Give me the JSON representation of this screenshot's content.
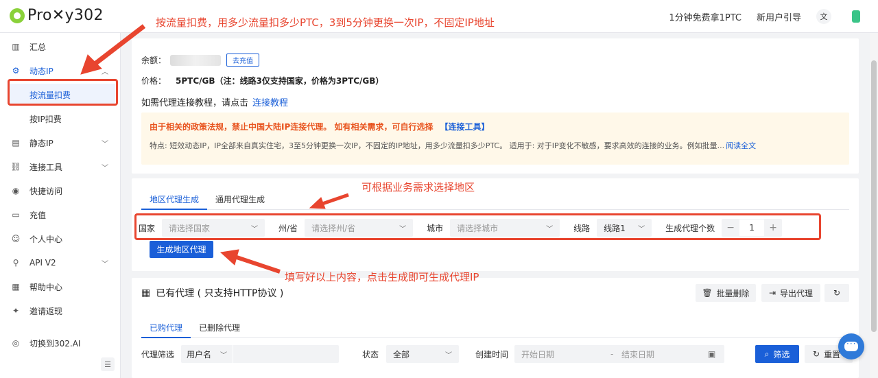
{
  "header": {
    "logo_text": "Pro✕y302",
    "free_link": "1分钟免费拿1PTC",
    "guide_link": "新用户引导",
    "lang_icon": "translate-icon"
  },
  "sidebar": {
    "items": [
      {
        "label": "汇总",
        "icon": "bar-chart-icon"
      },
      {
        "label": "动态IP",
        "icon": "gear-icon"
      },
      {
        "label": "按流量扣费"
      },
      {
        "label": "按IP扣费"
      },
      {
        "label": "静态IP",
        "icon": "server-icon"
      },
      {
        "label": "连接工具",
        "icon": "link-icon"
      },
      {
        "label": "快捷访问",
        "icon": "chrome-icon"
      },
      {
        "label": "充值",
        "icon": "card-icon"
      },
      {
        "label": "个人中心",
        "icon": "user-icon"
      },
      {
        "label": "API V2",
        "icon": "api-icon"
      },
      {
        "label": "帮助中心",
        "icon": "book-icon"
      },
      {
        "label": "邀请返现",
        "icon": "gift-icon"
      },
      {
        "label": "切换到302.AI",
        "icon": "switch-icon"
      }
    ]
  },
  "info": {
    "balance_label": "余额：",
    "recharge_button": "去充值",
    "price_label": "价格：",
    "price_value": "5PTC/GB（注：线路3仅支持国家，价格为3PTC/GB）",
    "tutorial_text": "如需代理连接教程，请点击",
    "tutorial_link": "连接教程",
    "notice_title": "由于相关的政策法规，禁止中国大陆IP连接代理。 如有相关需求，可自行选择",
    "notice_link": "【连接工具】",
    "notice_desc": "特点: 短效动态IP，IP全部来自真实住宅，3至5分钟更换一次IP，不固定的IP地址，用多少流量扣多少PTC。 适用于: 对于IP变化不敏感，要求高效的连接的业务。例如批量...",
    "read_more": "阅读全文"
  },
  "generator": {
    "tabs": [
      "地区代理生成",
      "通用代理生成"
    ],
    "country_label": "国家",
    "country_placeholder": "请选择国家",
    "state_label": "州/省",
    "state_placeholder": "请选择州/省",
    "city_label": "城市",
    "city_placeholder": "请选择城市",
    "line_label": "线路",
    "line_value": "线路1",
    "count_label": "生成代理个数",
    "count_value": "1",
    "generate_button": "生成地区代理"
  },
  "proxies": {
    "title": "已有代理 ( 只支持HTTP协议 )",
    "batch_delete": "批量删除",
    "export": "导出代理",
    "tabs": [
      "已购代理",
      "已删除代理"
    ],
    "filter_label": "代理筛选",
    "filter_type": "用户名",
    "status_label": "状态",
    "status_value": "全部",
    "created_label": "创建时间",
    "start_placeholder": "开始日期",
    "end_placeholder": "结束日期",
    "search_button": "筛选",
    "reset_button": "重置"
  },
  "annotations": {
    "top": "按流量扣费，用多少流量扣多少PTC，3到5分钟更换一次IP，不固定IP地址",
    "middle": "可根据业务需求选择地区",
    "bottom": "填写好以上内容，点击生成即可生成代理IP"
  },
  "colors": {
    "accent": "#1a5fd8",
    "annotation": "#e8452f",
    "notice_bg": "#fff8e9",
    "notice_title": "#e8541f"
  }
}
